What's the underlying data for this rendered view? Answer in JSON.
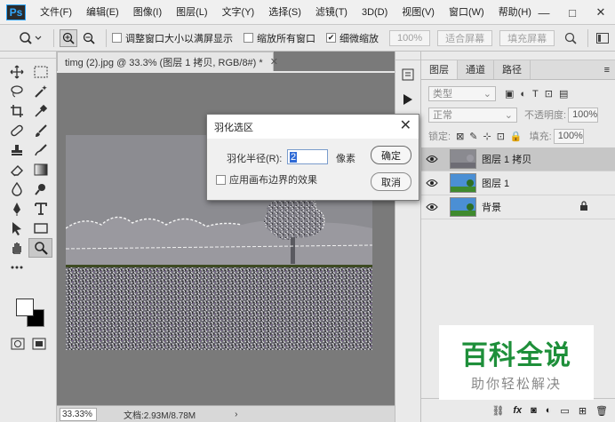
{
  "app": {
    "logo": "Ps",
    "menu": [
      "文件(F)",
      "编辑(E)",
      "图像(I)",
      "图层(L)",
      "文字(Y)",
      "选择(S)",
      "滤镜(T)",
      "3D(D)",
      "视图(V)",
      "窗口(W)",
      "帮助(H)"
    ],
    "window_controls": [
      "—",
      "□",
      "✕"
    ]
  },
  "options": {
    "chk_resize_windows": "调整窗口大小以满屏显示",
    "chk_zoom_all": "缩放所有窗口",
    "chk_scrubby_zoom": "细微缩放",
    "zoom_percent": "100%",
    "fit_screen": "适合屏幕",
    "fill_screen": "填充屏幕"
  },
  "document": {
    "tab_title": "timg (2).jpg @ 33.3% (图层 1 拷贝, RGB/8#) *",
    "zoom": "33.33%",
    "doc_size": "文档:2.93M/8.78M"
  },
  "layers_panel": {
    "tabs": [
      "图层",
      "通道",
      "路径"
    ],
    "filter_kind": "类型",
    "blend_mode": "正常",
    "opacity_label": "不透明度:",
    "opacity_value": "100%",
    "lock_label": "锁定:",
    "fill_label": "填充:",
    "fill_value": "100%",
    "layers": [
      {
        "name": "图层 1 拷贝",
        "selected": true
      },
      {
        "name": "图层 1",
        "selected": false
      },
      {
        "name": "背景",
        "selected": false,
        "locked": true
      }
    ]
  },
  "dialog": {
    "title": "羽化选区",
    "radius_label": "羽化半径(R):",
    "radius_value": "2",
    "unit": "像素",
    "checkbox_label": "应用画布边界的效果",
    "ok": "确定",
    "cancel": "取消"
  },
  "watermark": {
    "main": "百科全说",
    "sub": "助你轻松解决"
  },
  "colors": {
    "accent": "#31a8ff",
    "selection_blue": "#2f6bd6",
    "watermark_green": "#1e8f3a"
  }
}
